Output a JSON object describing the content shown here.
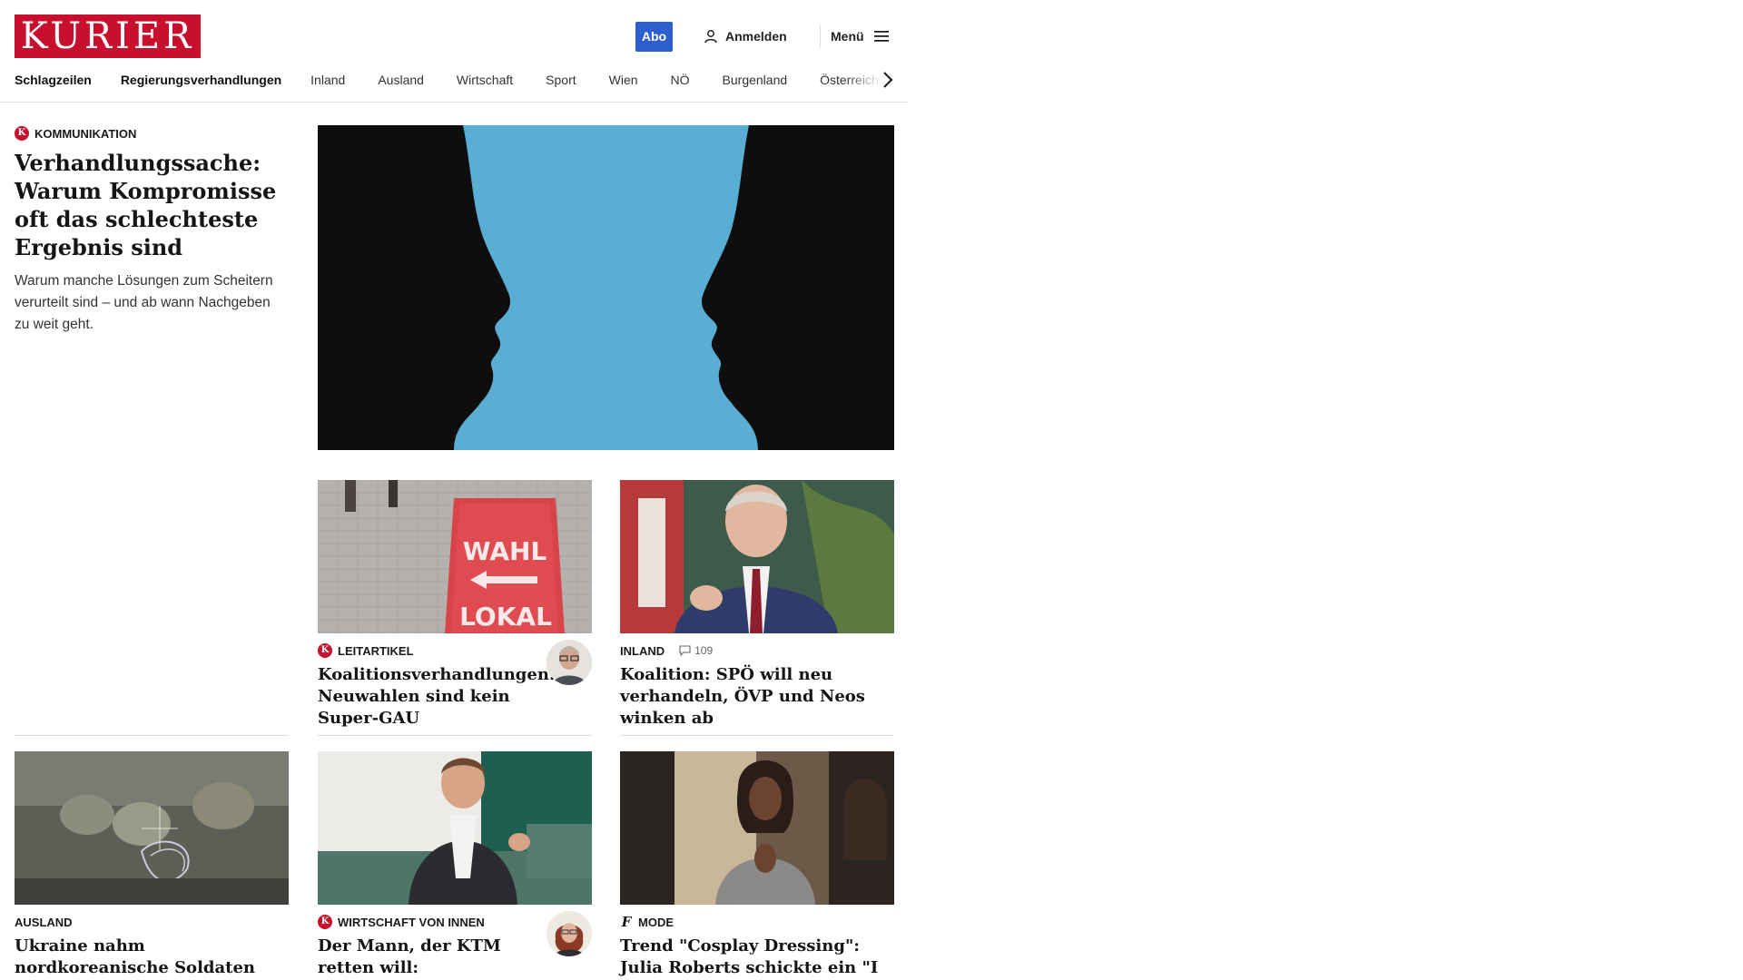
{
  "header": {
    "logo": "KURIER",
    "abo_label": "Abo",
    "login_label": "Anmelden",
    "menu_label": "Menü"
  },
  "nav": {
    "items": [
      "Schlagzeilen",
      "Regierungsverhandlungen",
      "Inland",
      "Ausland",
      "Wirtschaft",
      "Sport",
      "Wien",
      "NÖ",
      "Burgenland",
      "Österreich"
    ]
  },
  "lead": {
    "kicker": "KOMMUNIKATION",
    "badge": "K",
    "title": "Verhandlungssache: Warum Kompromisse oft das schlechteste Ergebnis sind",
    "teaser": "Warum manche Lösungen zum Scheitern verurteilt sind – und ab wann Nachgeben zu weit geht."
  },
  "articles": [
    {
      "kicker": "LEITARTIKEL",
      "badge": "K",
      "title": "Koalitionsverhandlungen: Neuwahlen sind kein Super-GAU",
      "image_text": [
        "WAHL",
        "LOKAL"
      ]
    },
    {
      "kicker": "INLAND",
      "comments": "109",
      "title": "Koalition: SPÖ will neu verhandeln, ÖVP und Neos winken ab"
    },
    {
      "kicker": "AUSLAND",
      "title": "Ukraine nahm nordkoreanische Soldaten fest, Russen erhöhen Druck in Kursk"
    },
    {
      "kicker": "WIRTSCHAFT VON INNEN",
      "badge": "K",
      "title": "Der Mann, der KTM retten will: Netzwerker, Dealmaker, Sanierer"
    },
    {
      "kicker": "MODE",
      "icon": "f",
      "title": "Trend \"Cosplay Dressing\": Julia Roberts schickte ein \"I love you\""
    }
  ],
  "colors": {
    "brand": "#c8102e",
    "abo": "#2f5ecf",
    "hero_bg": "#5aadd3"
  }
}
